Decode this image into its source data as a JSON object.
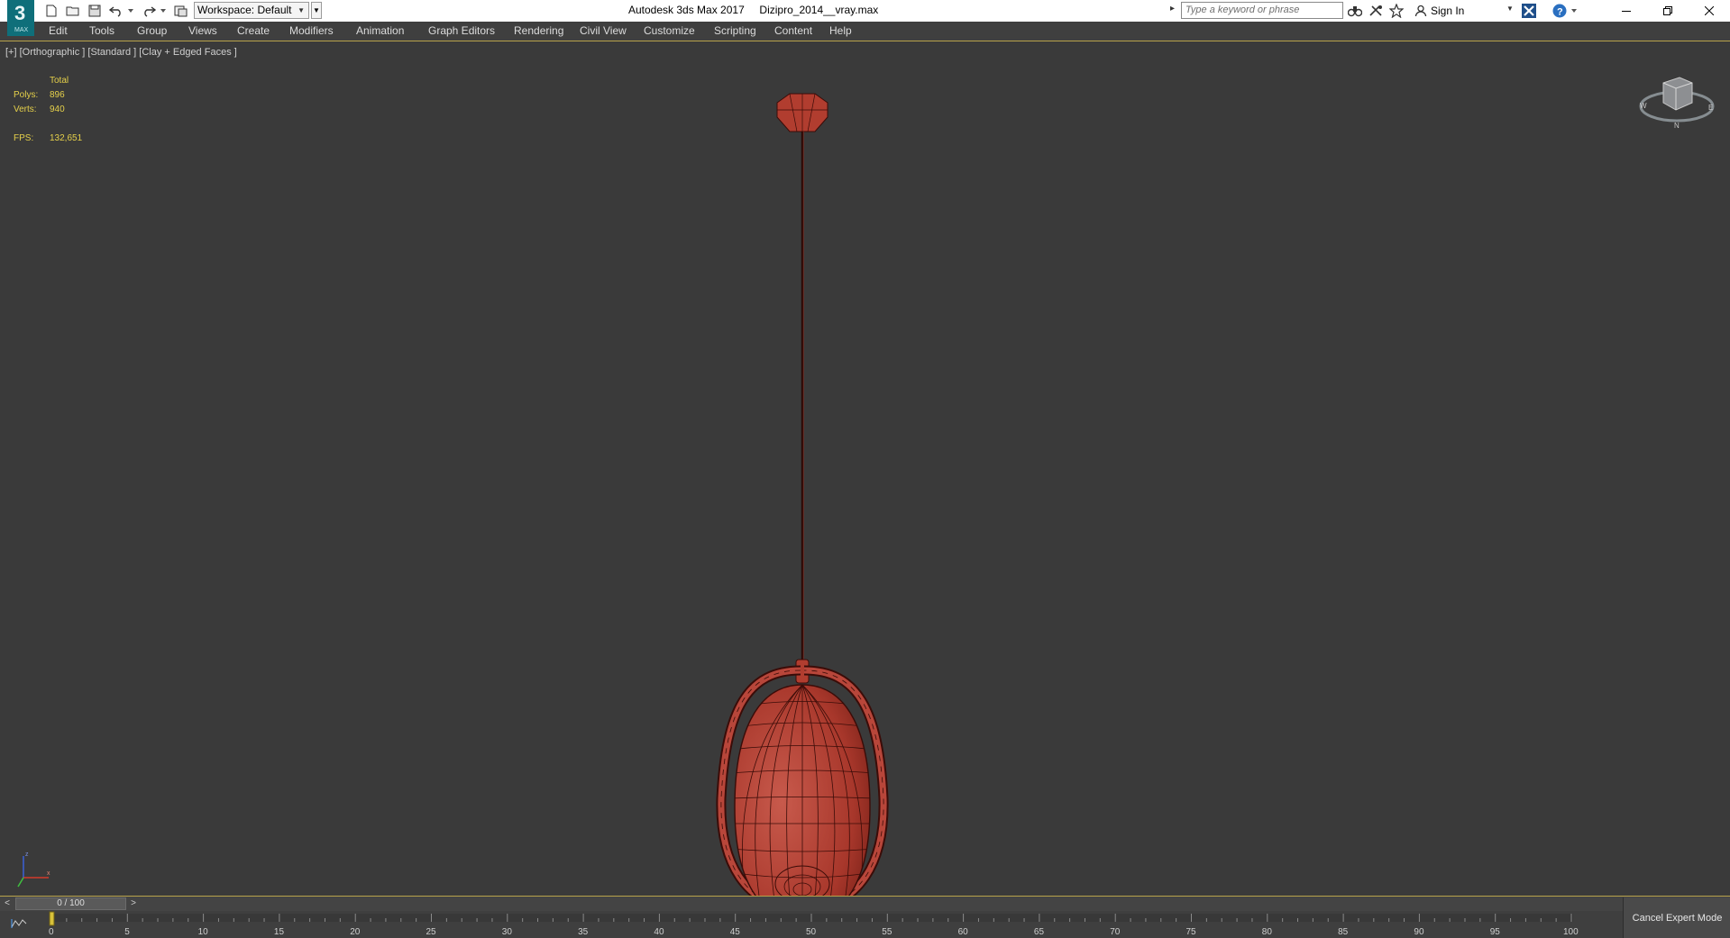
{
  "window": {
    "app_name": "Autodesk 3ds Max 2017",
    "file_name": "Dizipro_2014__vray.max",
    "logo_text": "3",
    "logo_sub": "MAX"
  },
  "toolbar": {
    "workspace_label": "Workspace: Default",
    "icons": [
      "new-file-icon",
      "open-file-icon",
      "save-icon",
      "undo-icon",
      "redo-icon",
      "project-folder-icon"
    ]
  },
  "search": {
    "placeholder": "Type a keyword or phrase",
    "sign_in": "Sign In"
  },
  "menu": {
    "items": [
      "Edit",
      "Tools",
      "Group",
      "Views",
      "Create",
      "Modifiers",
      "Animation",
      "Graph Editors",
      "Rendering",
      "Civil View",
      "Customize",
      "Scripting",
      "Content",
      "Help"
    ]
  },
  "viewport": {
    "label": "[+] [Orthographic ] [Standard ] [Clay + Edged Faces ]",
    "stats": {
      "total_label": "Total",
      "polys_label": "Polys:",
      "polys_value": "896",
      "verts_label": "Verts:",
      "verts_value": "940",
      "fps_label": "FPS:",
      "fps_value": "132,651"
    },
    "model_color": "#b03a2e",
    "stats_color": "#e5d04a"
  },
  "timeline": {
    "position_label": "0 / 100",
    "current_frame": 0,
    "frame_end": 100,
    "tick_labels": [
      "0",
      "5",
      "10",
      "15",
      "20",
      "25",
      "30",
      "35",
      "40",
      "45",
      "50",
      "55",
      "60",
      "65",
      "70",
      "75",
      "80",
      "85",
      "90",
      "95",
      "100"
    ],
    "cancel_expert_label": "Cancel Expert Mode"
  },
  "colors": {
    "accent_line": "#b8a24a",
    "viewport_bg": "#3a3a3a"
  }
}
